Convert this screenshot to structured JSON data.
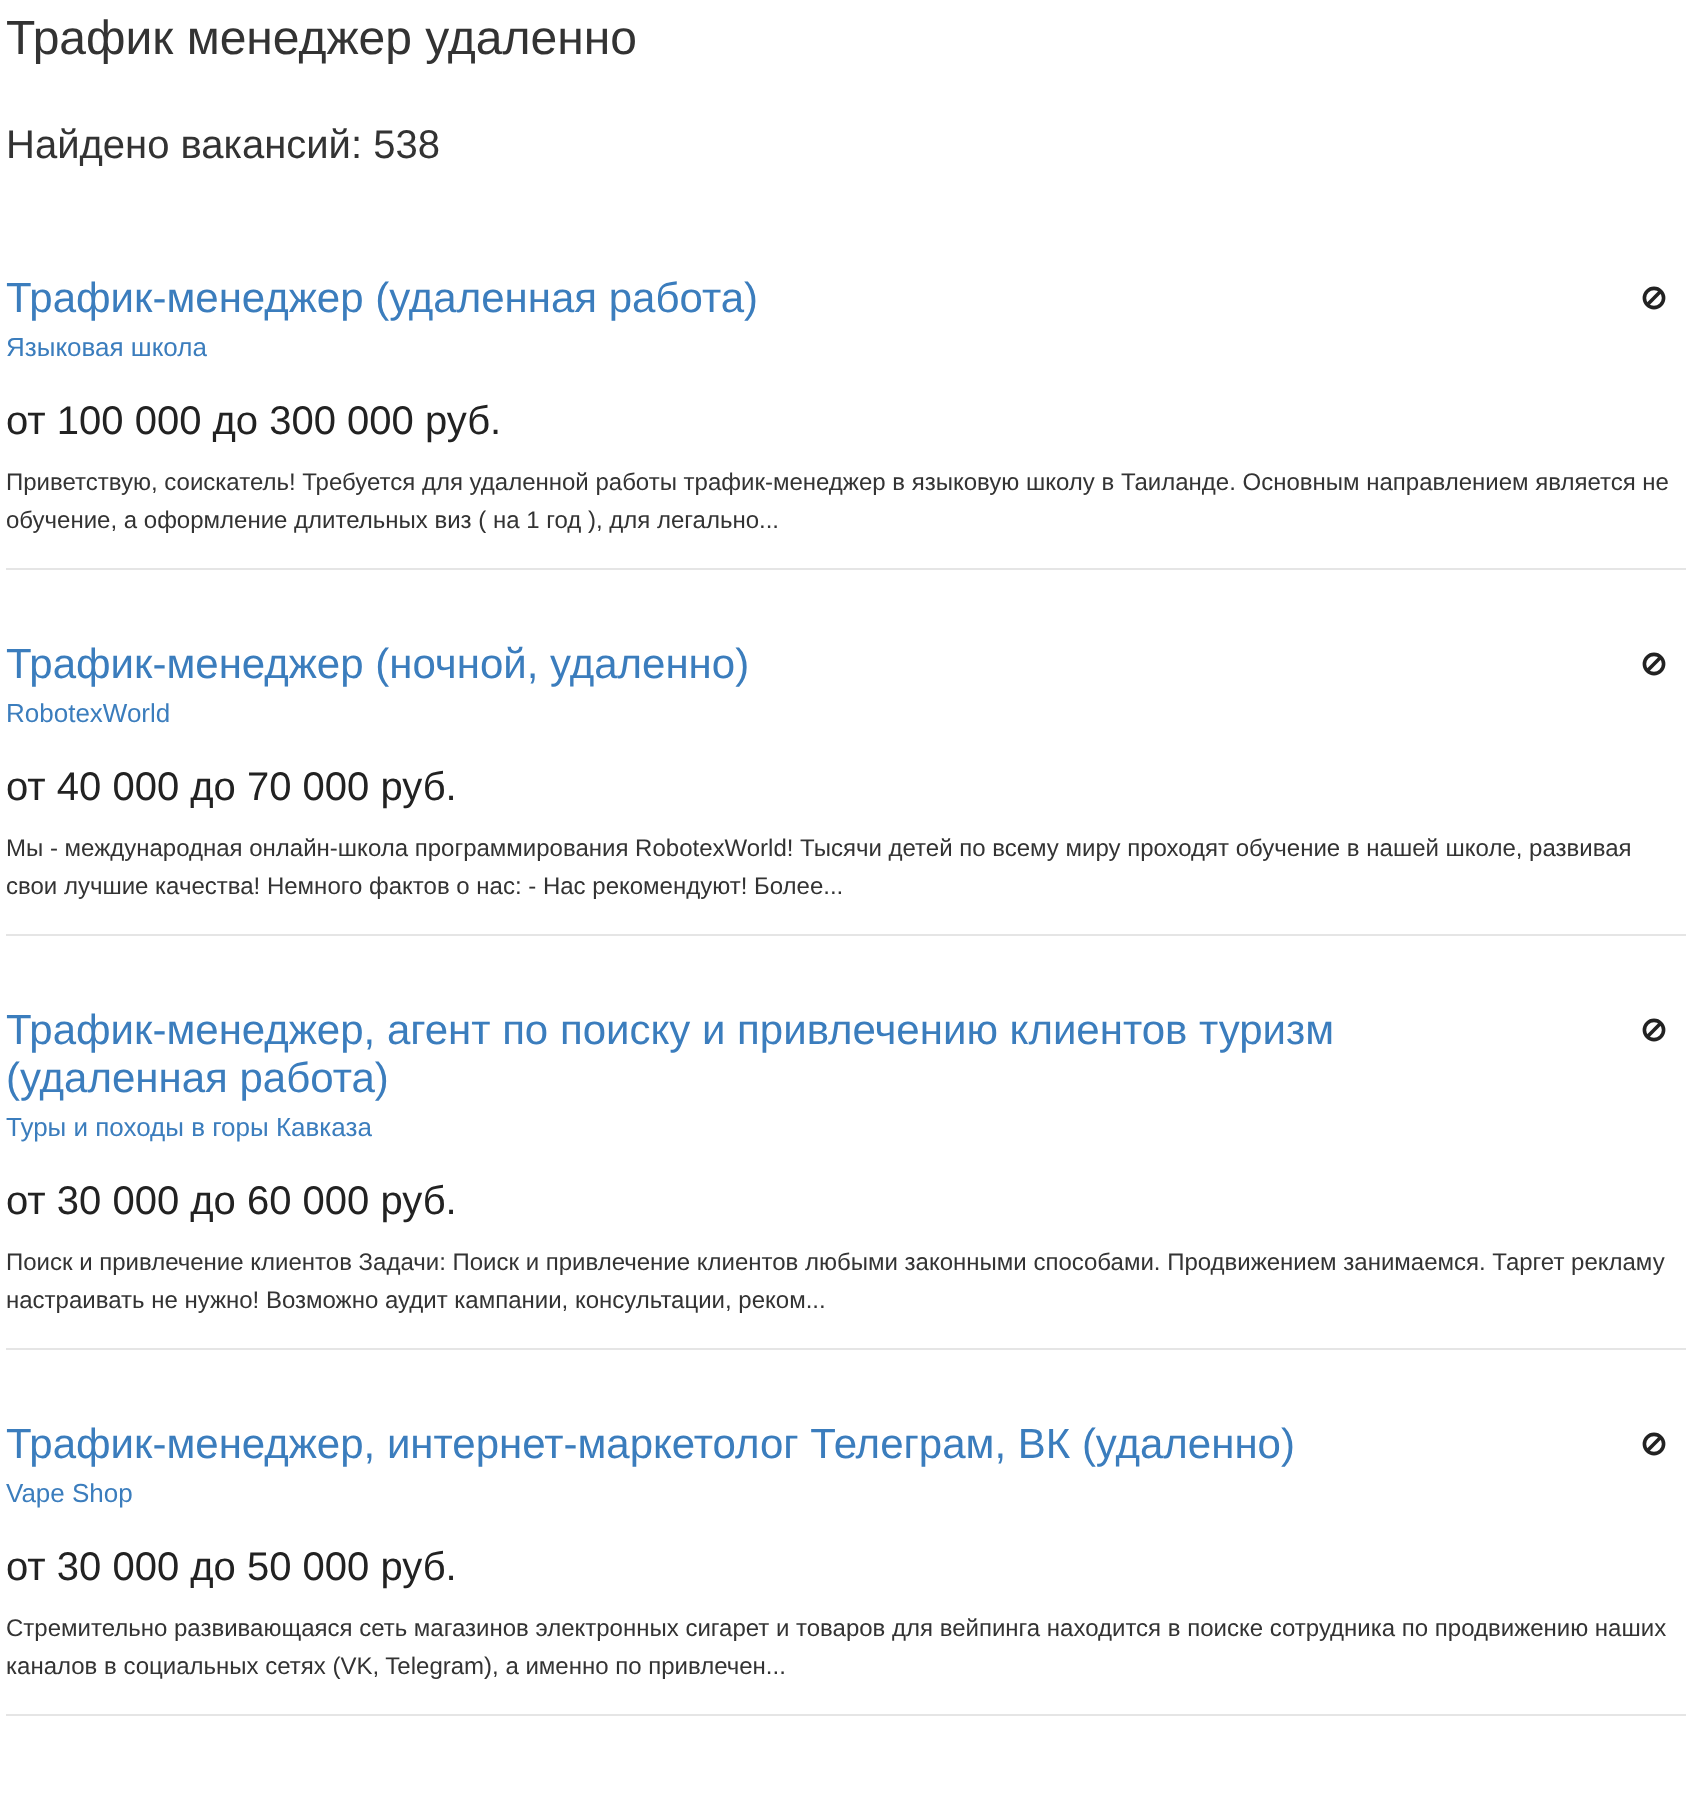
{
  "page": {
    "title": "Трафик менеджер удаленно",
    "found": "Найдено вакансий: 538"
  },
  "vacancies": [
    {
      "title": "Трафик-менеджер (удаленная работа)",
      "company": "Языковая школа",
      "salary": "от 100 000 до 300 000 руб.",
      "description": "Приветствую, соискатель! Требуется для удаленной работы трафик-менеджер в языковую школу в Таиланде. Основным направлением является не обучение, а оформление длительных виз ( на 1 год ), для легально..."
    },
    {
      "title": "Трафик-менеджер (ночной, удаленно)",
      "company": "RobotexWorld",
      "salary": "от 40 000 до 70 000 руб.",
      "description": "Мы - международная онлайн-школа программирования RobotexWorld! Тысячи детей по всему миру проходят обучение в нашей школе, развивая свои лучшие качества! Немного фактов о нас: - Нас рекомендуют! Более..."
    },
    {
      "title": "Трафик-менеджер, агент по поиску и привлечению клиентов туризм (удаленная работа)",
      "company": "Туры и походы в горы Кавказа",
      "salary": "от 30 000 до 60 000 руб.",
      "description": "Поиск и привлечение клиентов Задачи: Поиск и привлечение клиентов любыми законными способами. Продвижением занимаемся. Таргет рекламу настраивать не нужно! Возможно аудит кампании, консультации, реком..."
    },
    {
      "title": "Трафик-менеджер, интернет-маркетолог Телеграм, ВК (удаленно)",
      "company": "Vape Shop",
      "salary": "от 30 000 до 50 000 руб.",
      "description": "Стремительно развивающаяся сеть магазинов электронных сигарет и товаров для вейпинга находится в поиске сотрудника по продвижению наших каналов в социальных сетях (VK, Telegram), а именно по привлечен..."
    }
  ]
}
